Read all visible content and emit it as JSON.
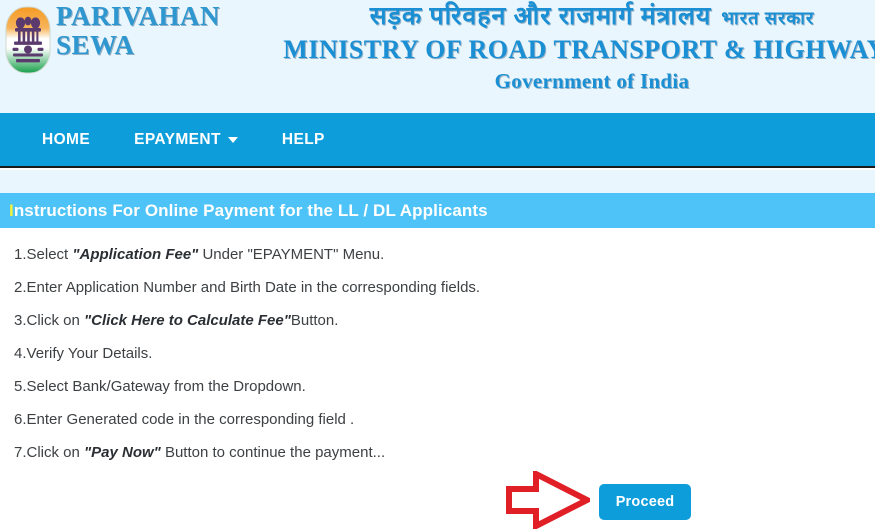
{
  "header": {
    "emblem_alt": "State Emblem of India",
    "brand_line1": "PARIVAHAN",
    "brand_line2": "SEWA",
    "ministry_hindi": "सड़क परिवहन और राजमार्ग मंत्रालय",
    "gov_hindi": "भारत सरकार",
    "ministry_english": "MINISTRY OF ROAD TRANSPORT & HIGHWAYS",
    "government": "Government of India",
    "background_color": "#eaf6fd",
    "text_color": "#1b8fd4"
  },
  "nav": {
    "background_color": "#0d9ddb",
    "items": [
      {
        "label": "HOME",
        "has_caret": false
      },
      {
        "label": "EPAYMENT",
        "has_caret": true
      },
      {
        "label": "HELP",
        "has_caret": false
      }
    ]
  },
  "instructions_panel": {
    "bar_color": "#4ec3f7",
    "title_lead": "I",
    "title_lead_color": "#f2f23a",
    "title_rest": "nstructions For Online Payment for the LL / DL Applicants",
    "items": [
      {
        "number": "1.",
        "pre": "Select ",
        "emphasis": "\"Application Fee\"",
        "post": " Under \"EPAYMENT\" Menu."
      },
      {
        "number": "2.",
        "pre": "Enter Application Number and Birth Date in the corresponding fields.",
        "emphasis": "",
        "post": ""
      },
      {
        "number": "3.",
        "pre": "Click on ",
        "emphasis": "\"Click Here to Calculate Fee\"",
        "post": "Button."
      },
      {
        "number": "4.",
        "pre": "Verify Your Details.",
        "emphasis": "",
        "post": ""
      },
      {
        "number": "5.",
        "pre": "Select Bank/Gateway from the Dropdown.",
        "emphasis": "",
        "post": ""
      },
      {
        "number": "6.",
        "pre": "Enter Generated code in the corresponding field .",
        "emphasis": "",
        "post": ""
      },
      {
        "number": "7.",
        "pre": "Click on ",
        "emphasis": "\"Pay Now\"",
        "post": " Button to continue the payment..."
      }
    ]
  },
  "footer_action": {
    "arrow_color": "#e01f26",
    "arrow_direction": "right",
    "proceed_label": "Proceed",
    "proceed_color": "#0d9ddb"
  }
}
